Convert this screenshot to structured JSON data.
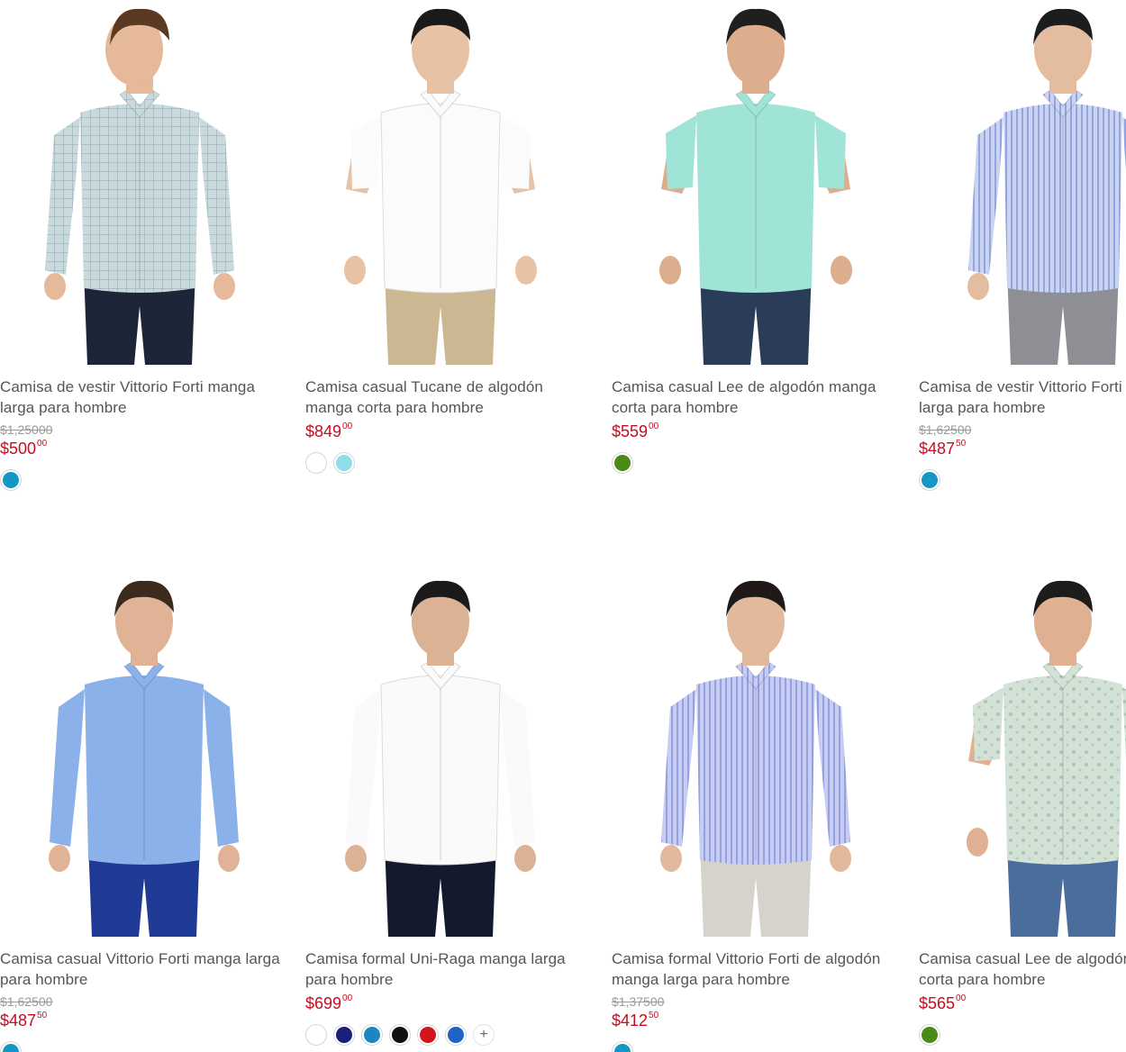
{
  "products": [
    {
      "title": "Camisa de vestir Vittorio Forti manga larga para hombre",
      "old_price": "$1,250",
      "old_cents": "00",
      "price": "$500",
      "cents": "00",
      "swatches": [
        "#1597c6"
      ]
    },
    {
      "title": "Camisa casual Tucane de algodón manga corta para hombre",
      "old_price": "",
      "old_cents": "",
      "price": "$849",
      "cents": "00",
      "swatches": [
        "#ffffff",
        "#8fdde8"
      ]
    },
    {
      "title": "Camisa casual Lee de algodón manga corta para hombre",
      "old_price": "",
      "old_cents": "",
      "price": "$559",
      "cents": "00",
      "swatches": [
        "#4c8a17"
      ]
    },
    {
      "title": "Camisa de vestir Vittorio Forti manga larga para hombre",
      "old_price": "$1,625",
      "old_cents": "00",
      "price": "$487",
      "cents": "50",
      "swatches": [
        "#1597c6"
      ]
    },
    {
      "title": "Camisa casual Vittorio Forti manga larga para hombre",
      "old_price": "$1,625",
      "old_cents": "00",
      "price": "$487",
      "cents": "50",
      "swatches": [
        "#1597c6"
      ]
    },
    {
      "title": "Camisa formal Uni-Raga manga larga para hombre",
      "old_price": "",
      "old_cents": "",
      "price": "$699",
      "cents": "00",
      "swatches": [
        "#ffffff",
        "#1a1f7a",
        "#1b86c2",
        "#111111",
        "#d2151c",
        "#1f63c6"
      ],
      "more": "+"
    },
    {
      "title": "Camisa formal Vittorio Forti de algodón manga larga para hombre",
      "old_price": "$1,375",
      "old_cents": "00",
      "price": "$412",
      "cents": "50",
      "swatches": [
        "#1597c6"
      ]
    },
    {
      "title": "Camisa casual Lee de algodón manga corta para hombre",
      "old_price": "",
      "old_cents": "",
      "price": "$565",
      "cents": "00",
      "swatches": [
        "#4c8a17"
      ]
    }
  ],
  "images": [
    {
      "shirt": "#c9d9dc",
      "pattern": "check",
      "pants": "#1d2538",
      "hair": "#5a3a22",
      "skin": "#e5b99a",
      "sleeve": "long",
      "pose": "side"
    },
    {
      "shirt": "#fbfbfb",
      "pattern": "plain",
      "pants": "#cbb792",
      "hair": "#1a1a1a",
      "skin": "#e8c2a4",
      "sleeve": "short",
      "pose": "walk"
    },
    {
      "shirt": "#9fe4d7",
      "pattern": "plain",
      "pants": "#2b3c59",
      "hair": "#1f1f1f",
      "skin": "#dcae8e",
      "sleeve": "short",
      "pose": "hand"
    },
    {
      "shirt": "#c9d3f2",
      "pattern": "stripe",
      "pants": "#8d8f94",
      "hair": "#1d1d1d",
      "skin": "#e4bda0",
      "sleeve": "long",
      "pose": "front"
    },
    {
      "shirt": "#8ab1ea",
      "pattern": "plain",
      "pants": "#1e3a94",
      "hair": "#3b2a1e",
      "skin": "#e0b396",
      "sleeve": "long",
      "pose": "pocket"
    },
    {
      "shirt": "#fafafa",
      "pattern": "plain",
      "pants": "#141a2e",
      "hair": "#1a1a1a",
      "skin": "#dcb294",
      "sleeve": "long",
      "pose": "walk"
    },
    {
      "shirt": "#c6ccf2",
      "pattern": "stripe",
      "pants": "#d6d2cc",
      "hair": "#1f1a17",
      "skin": "#e2b99c",
      "sleeve": "long",
      "pose": "front"
    },
    {
      "shirt": "#d3e2d7",
      "pattern": "floral",
      "pants": "#4b6d9b",
      "hair": "#1c1c1c",
      "skin": "#dfb092",
      "sleeve": "short",
      "pose": "front"
    }
  ]
}
